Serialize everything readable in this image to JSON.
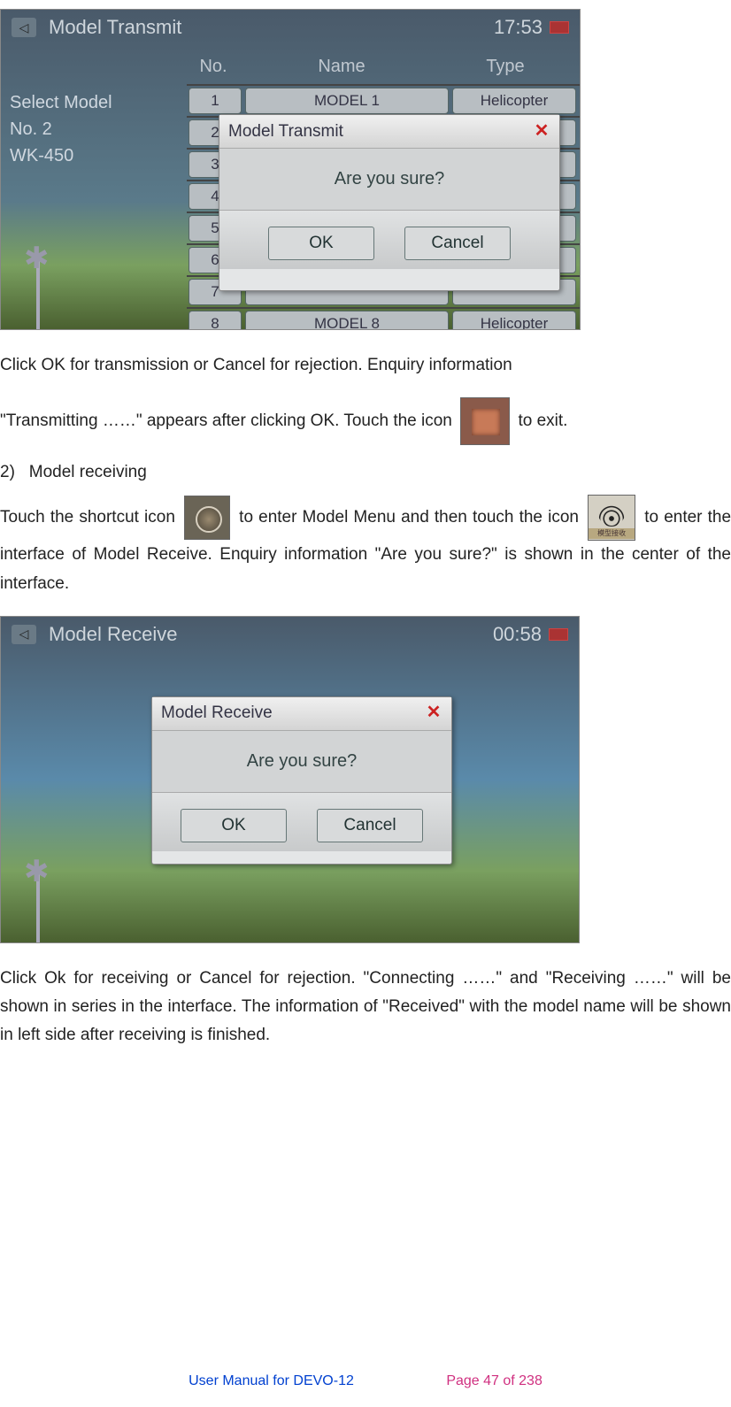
{
  "screenshot1": {
    "title": "Model Transmit",
    "time": "17:53",
    "sidebar_label": "Select Model",
    "sidebar_no": "No. 2",
    "sidebar_name": "WK-450",
    "columns": {
      "no": "No.",
      "name": "Name",
      "type": "Type"
    },
    "rows": [
      {
        "no": "1",
        "name": "MODEL 1",
        "type": "Helicopter"
      },
      {
        "no": "2",
        "name": "",
        "type": ""
      },
      {
        "no": "3",
        "name": "",
        "type": ""
      },
      {
        "no": "4",
        "name": "",
        "type": ""
      },
      {
        "no": "5",
        "name": "",
        "type": ""
      },
      {
        "no": "6",
        "name": "",
        "type": ""
      },
      {
        "no": "7",
        "name": "",
        "type": ""
      },
      {
        "no": "8",
        "name": "MODEL 8",
        "type": "Helicopter"
      }
    ],
    "dialog": {
      "title": "Model Transmit",
      "message": "Are you sure?",
      "ok": "OK",
      "cancel": "Cancel"
    }
  },
  "para1a": "Click OK for transmission or Cancel for rejection. Enquiry information",
  "para1b_pre": "\"Transmitting ……\" appears after clicking OK. Touch the icon",
  "para1b_post": "to exit.",
  "section2_num": "2)",
  "section2_title": "Model receiving",
  "para2_pre": "Touch the shortcut icon",
  "para2_mid": "to enter Model Menu and then touch the icon",
  "para2_post": "to enter the interface of Model Receive. Enquiry information \"Are you sure?\" is shown in the center of the interface.",
  "screenshot2": {
    "title": "Model Receive",
    "time": "00:58",
    "dialog": {
      "title": "Model Receive",
      "message": "Are you sure?",
      "ok": "OK",
      "cancel": "Cancel"
    }
  },
  "para3": "Click Ok for receiving or Cancel for rejection. \"Connecting ……\" and \"Receiving ……\" will be shown in series in the interface. The information of \"Received\" with the model name will be shown in left side after receiving is finished.",
  "footer_left": "User Manual for DEVO-12",
  "footer_right": "Page 47 of 238",
  "wifi_label": "模型接收"
}
